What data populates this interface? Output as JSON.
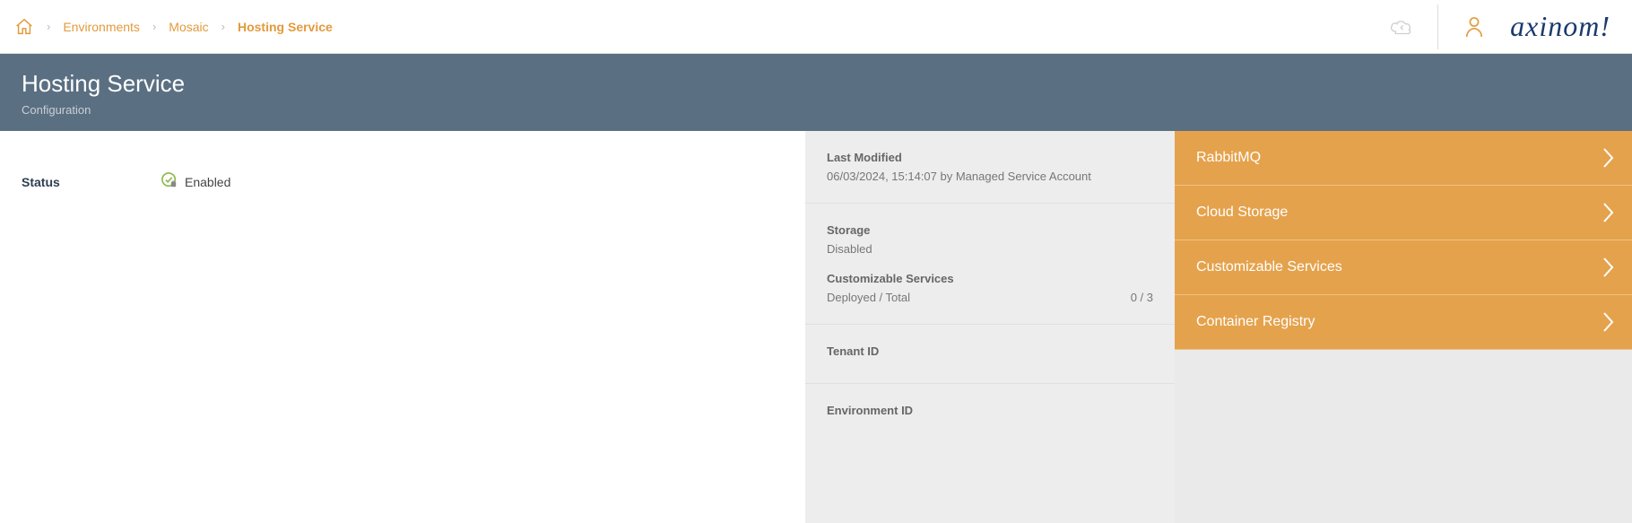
{
  "breadcrumb": {
    "environments": "Environments",
    "mosaic": "Mosaic",
    "current": "Hosting Service"
  },
  "brand": "axinom!",
  "header": {
    "title": "Hosting Service",
    "subtitle": "Configuration"
  },
  "status": {
    "label": "Status",
    "value": "Enabled"
  },
  "info": {
    "lastModified": {
      "label": "Last Modified",
      "value": "06/03/2024, 15:14:07 by Managed Service Account"
    },
    "storage": {
      "label": "Storage",
      "value": "Disabled"
    },
    "custom": {
      "label": "Customizable Services",
      "key": "Deployed / Total",
      "ratio": "0 / 3"
    },
    "tenant": {
      "label": "Tenant ID"
    },
    "environment": {
      "label": "Environment ID"
    }
  },
  "nav": {
    "rabbitmq": "RabbitMQ",
    "cloudStorage": "Cloud Storage",
    "customizable": "Customizable Services",
    "containerRegistry": "Container Registry"
  }
}
